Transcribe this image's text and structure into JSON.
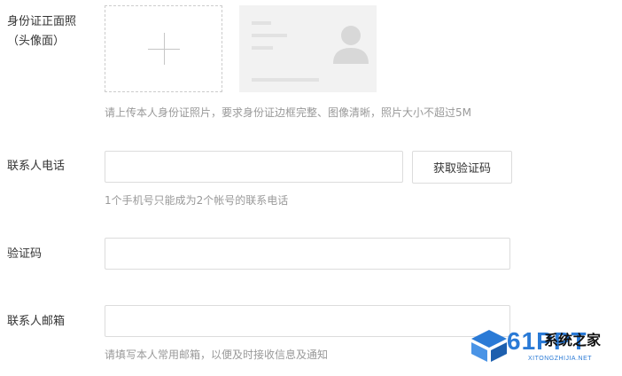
{
  "id_front": {
    "label_line1": "身份证正面照",
    "label_line2": "（头像面）",
    "hint": "请上传本人身份证照片，要求身份证边框完整、图像清晰，照片大小不超过5M"
  },
  "phone": {
    "label": "联系人电话",
    "value": "",
    "get_code_button": "获取验证码",
    "hint": "1个手机号只能成为2个帐号的联系电话"
  },
  "code": {
    "label": "验证码",
    "value": ""
  },
  "email": {
    "label": "联系人邮箱",
    "value": "",
    "hint": "请填写本人常用邮箱，以便及时接收信息及通知"
  },
  "watermark": {
    "brand": "61PPT",
    "text": "系统之家",
    "url": "XITONGZHIJIA.NET"
  },
  "colors": {
    "border": "#dcdcdc",
    "hint": "#999999",
    "sample_bg": "#f2f2f2",
    "watermark_blue": "#2a7ad6"
  },
  "icons": [
    "plus-icon",
    "id-card-sample-icon",
    "logo-icon"
  ]
}
